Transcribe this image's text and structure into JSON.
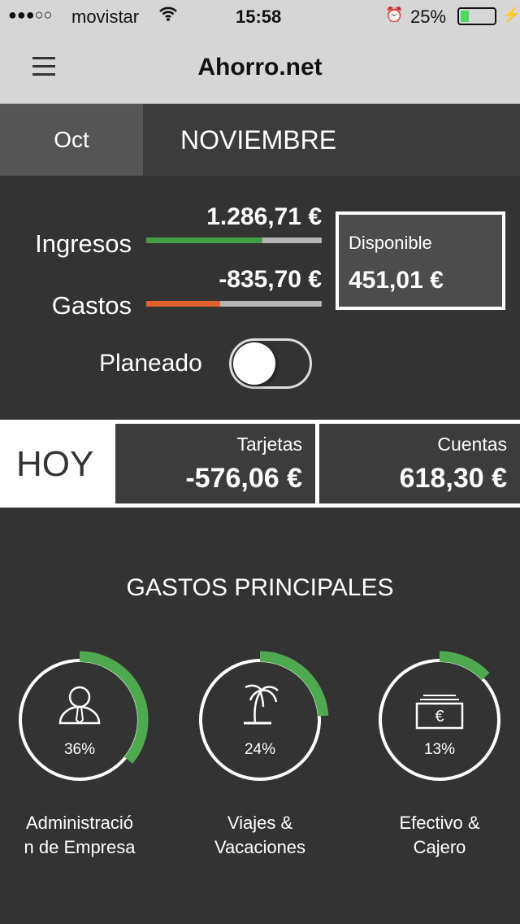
{
  "status": {
    "carrier": "movistar",
    "time": "15:58",
    "battery": "25%",
    "battery_level": 0.25
  },
  "nav": {
    "title": "Ahorro.net",
    "menu_icon": "hamburger-icon"
  },
  "months": {
    "prev": "Oct",
    "current": "NOVIEMBRE"
  },
  "summary": {
    "ingresos_label": "Ingresos",
    "ingresos_value": "1.286,71 €",
    "ingresos_fill": 0.66,
    "gastos_label": "Gastos",
    "gastos_value": "-835,70 €",
    "gastos_fill": 0.42,
    "disponible_label": "Disponible",
    "disponible_value": "451,01 €",
    "planeado_label": "Planeado",
    "planeado_on": false
  },
  "colors": {
    "green": "#43a047",
    "orange": "#e0612a",
    "ring_green": "#4faa4f"
  },
  "hoy": {
    "label": "HOY",
    "tarjetas_label": "Tarjetas",
    "tarjetas_value": "-576,06 €",
    "cuentas_label": "Cuentas",
    "cuentas_value": "618,30 €"
  },
  "gastos_principales": {
    "title": "GASTOS PRINCIPALES",
    "items": [
      {
        "icon": "businessman-icon",
        "percent_label": "36%",
        "percent": 36,
        "label_line1": "Administració",
        "label_line2": "n de Empresa"
      },
      {
        "icon": "palm-tree-icon",
        "percent_label": "24%",
        "percent": 24,
        "label_line1": "Viajes &",
        "label_line2": "Vacaciones"
      },
      {
        "icon": "banknote-euro-icon",
        "percent_label": "13%",
        "percent": 13,
        "label_line1": "Efectivo &",
        "label_line2": "Cajero"
      }
    ]
  }
}
